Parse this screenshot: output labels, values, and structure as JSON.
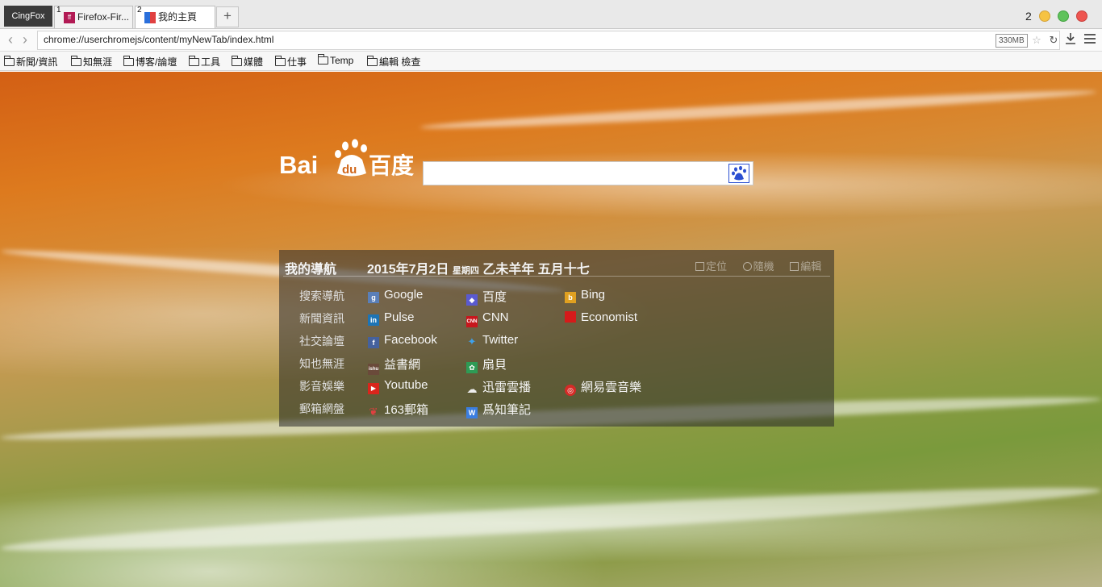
{
  "tabbar": {
    "brand": "CingFox",
    "tabs": [
      {
        "index": "1",
        "title": "Firefox-Fir..."
      },
      {
        "index": "2",
        "title": "我的主頁"
      }
    ],
    "new_tab": "+",
    "window_count": "2"
  },
  "navbar": {
    "url": "chrome://userchromejs/content/myNewTab/index.html",
    "memory": "330MB"
  },
  "bookmarks": [
    "新聞/資訊",
    "知無涯",
    "博客/論壇",
    "工具",
    "媒體",
    "仕事",
    "Temp",
    "編輯 檢查"
  ],
  "search": {
    "logo_text_bai": "Bai",
    "logo_text_du": "du",
    "logo_text_cn": "百度",
    "value": ""
  },
  "panel": {
    "title": "我的導航",
    "date": "2015年7月2日",
    "weekday": "星期四",
    "lunar": "乙未羊年 五月十七",
    "tools": [
      "定位",
      "隨機",
      "編輯"
    ],
    "categories": [
      {
        "name": "搜索導航",
        "links": [
          {
            "label": "Google",
            "icon": "google-icon",
            "color": "#5a7fb8"
          },
          {
            "label": "百度",
            "icon": "baidu-icon",
            "color": "#5a5ad0"
          },
          {
            "label": "Bing",
            "icon": "bing-icon",
            "color": "#e0a020"
          }
        ]
      },
      {
        "name": "新聞資訊",
        "links": [
          {
            "label": "Pulse",
            "icon": "linkedin-pulse-icon",
            "color": "#1d74b5"
          },
          {
            "label": "CNN",
            "icon": "cnn-icon",
            "color": "#c8161d"
          },
          {
            "label": "Economist",
            "icon": "economist-icon",
            "color": "#d61a1a"
          }
        ]
      },
      {
        "name": "社交論壇",
        "links": [
          {
            "label": "Facebook",
            "icon": "facebook-icon",
            "color": "#45619d"
          },
          {
            "label": "Twitter",
            "icon": "twitter-icon",
            "color": "#3ea1ec"
          }
        ]
      },
      {
        "name": "知也無涯",
        "links": [
          {
            "label": "益書網",
            "icon": "yishu-icon",
            "color": "#6a4a3a"
          },
          {
            "label": "扇貝",
            "icon": "shanbay-icon",
            "color": "#2e9b55"
          }
        ]
      },
      {
        "name": "影音娛樂",
        "links": [
          {
            "label": "Youtube",
            "icon": "youtube-icon",
            "color": "#d9251c"
          },
          {
            "label": "迅雷雲播",
            "icon": "xunlei-cloud-icon",
            "color": "#dddddd"
          },
          {
            "label": "網易雲音樂",
            "icon": "netease-music-icon",
            "color": "#d52b27"
          }
        ]
      },
      {
        "name": "郵箱網盤",
        "links": [
          {
            "label": "163郵箱",
            "icon": "mail163-icon",
            "color": "#c92d2d"
          },
          {
            "label": "爲知筆記",
            "icon": "wiz-note-icon",
            "color": "#3b7ee0"
          }
        ]
      }
    ]
  }
}
